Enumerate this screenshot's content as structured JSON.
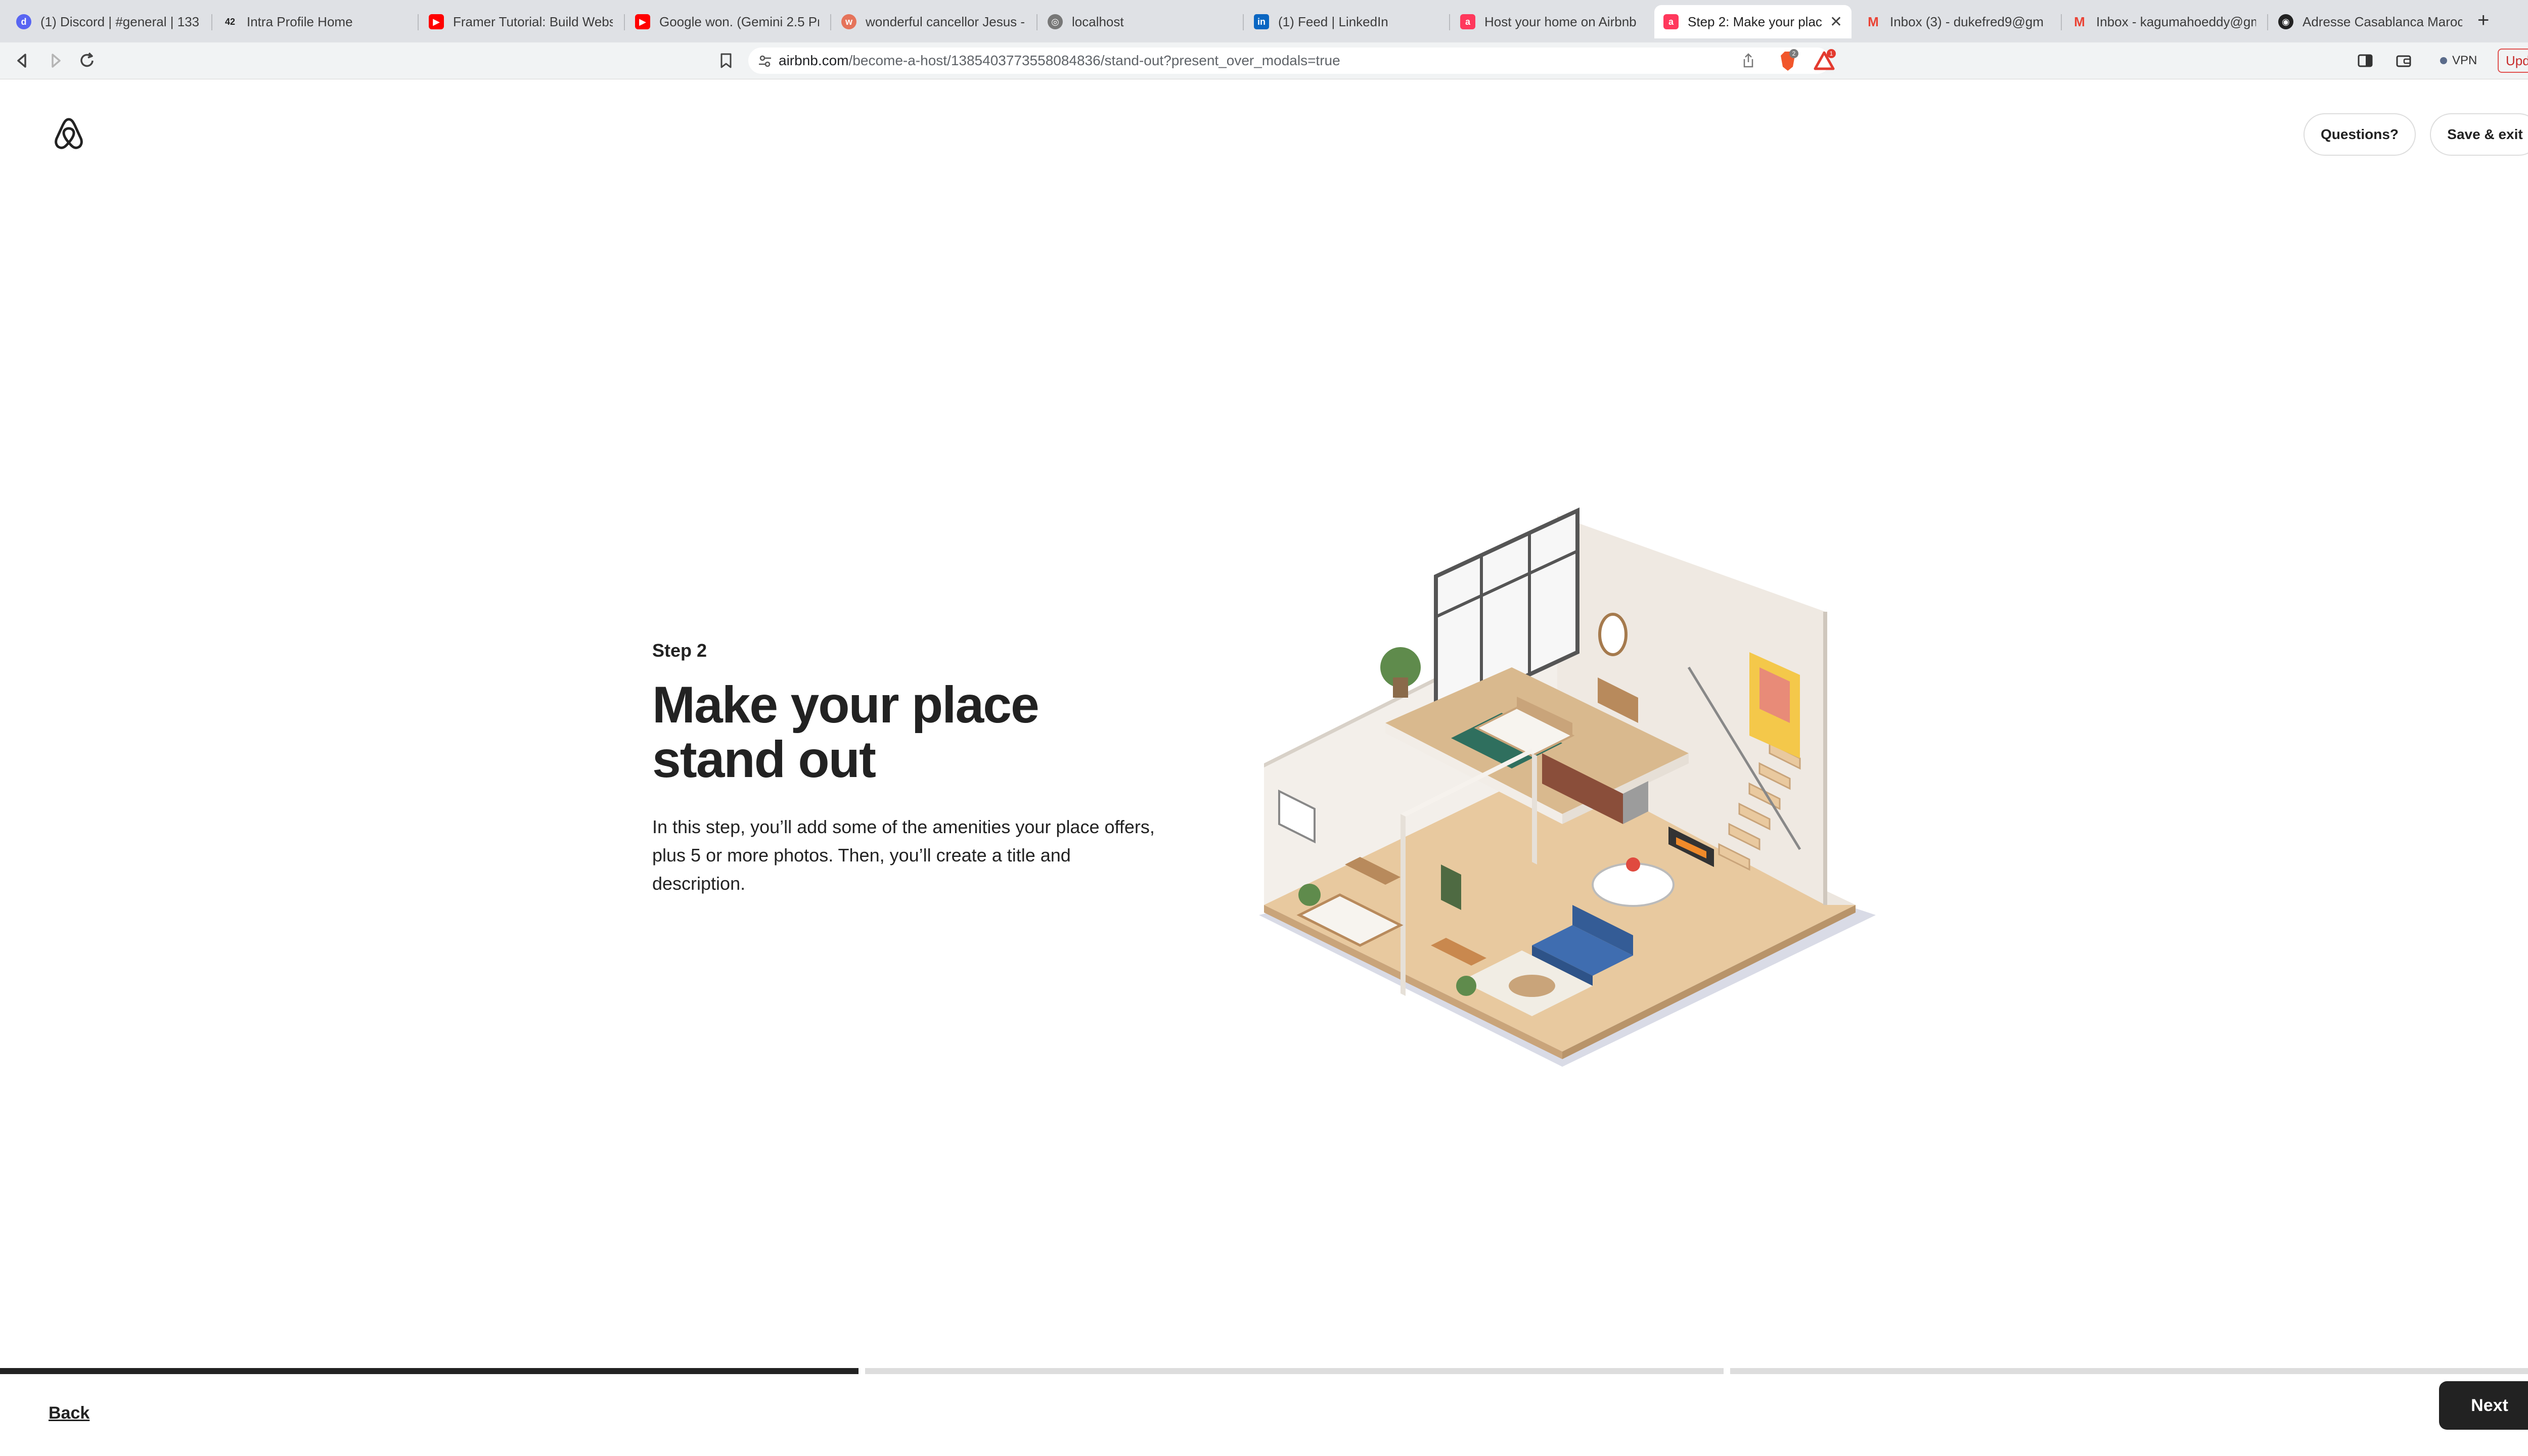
{
  "browser": {
    "tabs": [
      {
        "title": "(1) Discord | #general | 133",
        "icon": "discord-icon",
        "color": "#5865F2"
      },
      {
        "title": "Intra Profile Home",
        "icon": "42-logo-icon",
        "color": "#222222"
      },
      {
        "title": "Framer Tutorial: Build Webs",
        "icon": "youtube-icon",
        "color": "#FF0000"
      },
      {
        "title": "Google won. (Gemini 2.5 Pr",
        "icon": "youtube-icon",
        "color": "#FF0000"
      },
      {
        "title": "wonderful cancellor Jesus -",
        "icon": "site-icon",
        "color": "#E5735A"
      },
      {
        "title": "localhost",
        "icon": "globe-icon",
        "color": "#777777"
      },
      {
        "title": "(1) Feed | LinkedIn",
        "icon": "linkedin-icon",
        "color": "#0A66C2"
      },
      {
        "title": "Host your home on Airbnb",
        "icon": "airbnb-icon",
        "color": "#FF385C"
      },
      {
        "title": "Step 2: Make your plac",
        "icon": "airbnb-icon",
        "color": "#FF385C",
        "active": true
      },
      {
        "title": "Inbox (3) - dukefred9@gm",
        "icon": "gmail-icon",
        "color": "#EA4335"
      },
      {
        "title": "Inbox - kagumahoeddy@gm",
        "icon": "gmail-icon",
        "color": "#EA4335"
      },
      {
        "title": "Adresse Casablanca Maroc",
        "icon": "site-icon",
        "color": "#222222"
      }
    ],
    "new_tab_label": "+",
    "url_host": "airbnb.com",
    "url_path": "/become-a-host/1385403773558084836/stand-out?present_over_modals=true",
    "shield_count": "2",
    "alert_count": "1",
    "vpn_label": "VPN",
    "update_label": "Update"
  },
  "page": {
    "questions_label": "Questions?",
    "save_exit_label": "Save & exit",
    "step_label": "Step 2",
    "headline": "Make your place stand out",
    "description": "In this step, you’ll add some of the amenities your place offers, plus 5 or more photos. Then, you’ll create a title and description.",
    "illustration": "isometric-two-story-home-illustration"
  },
  "footer": {
    "progress": [
      1.0,
      0.0,
      0.0
    ],
    "back_label": "Back",
    "next_label": "Next"
  },
  "colors": {
    "brand": "#FF385C",
    "text": "#222222",
    "progress_fill": "#222222",
    "progress_track": "#DDDDDD",
    "next_bg": "#222222"
  }
}
